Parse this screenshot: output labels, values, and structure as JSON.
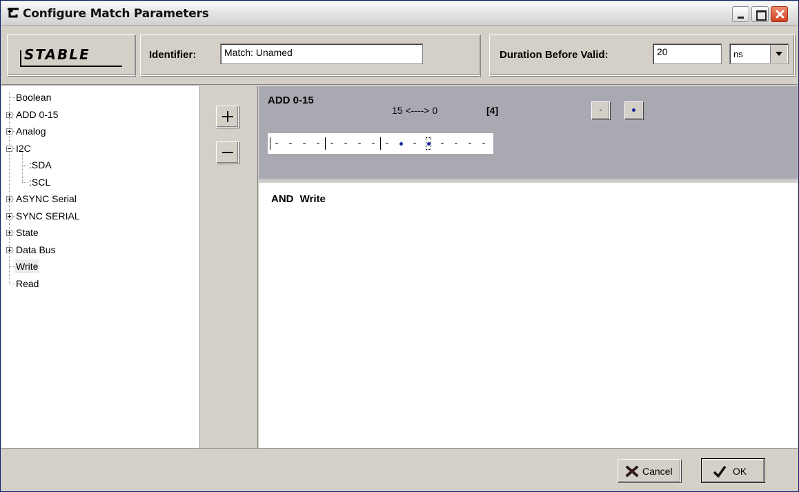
{
  "window": {
    "title": "Configure Match Parameters"
  },
  "header": {
    "logo": "STABLE",
    "identifier_label": "Identifier:",
    "identifier_value": "Match: Unamed",
    "duration_label": "Duration Before Valid:",
    "duration_value": "20",
    "duration_unit": "ns"
  },
  "tree": {
    "items": [
      {
        "label": "Boolean",
        "expander": "none"
      },
      {
        "label": "ADD 0-15",
        "expander": "plus"
      },
      {
        "label": "Analog",
        "expander": "plus"
      },
      {
        "label": "I2C",
        "expander": "minus"
      },
      {
        "label": ":SDA",
        "expander": "none"
      },
      {
        "label": ":SCL",
        "expander": "none"
      },
      {
        "label": "ASYNC Serial",
        "expander": "plus"
      },
      {
        "label": "SYNC SERIAL",
        "expander": "plus"
      },
      {
        "label": "State",
        "expander": "plus"
      },
      {
        "label": "Data Bus",
        "expander": "plus"
      },
      {
        "label": "Write",
        "expander": "none",
        "selected": true
      },
      {
        "label": "Read",
        "expander": "none"
      }
    ]
  },
  "signal": {
    "name": "ADD 0-15",
    "range": "15 <----> 0",
    "count": "[4]",
    "dash_button": "-",
    "bits": [
      "-",
      "-",
      "-",
      "-",
      "-",
      "-",
      "-",
      "-",
      "-",
      "dot",
      "-",
      "dot",
      "-",
      "-",
      "-",
      "-"
    ]
  },
  "expression": {
    "text": "AND Write"
  },
  "footer": {
    "cancel_label": "Cancel",
    "ok_label": "OK"
  },
  "icons": {
    "app": "app-logo-icon",
    "cancel": "red-x-icon",
    "ok": "checkmark-icon"
  }
}
